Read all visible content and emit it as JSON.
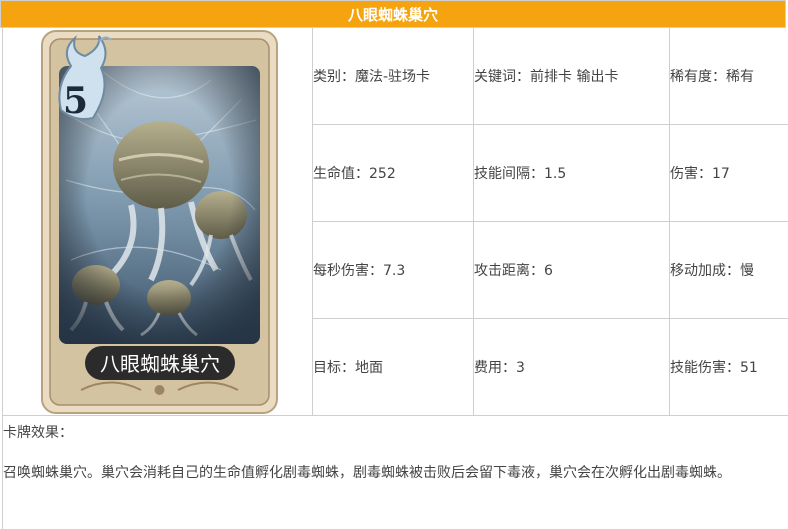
{
  "title": "八眼蜘蛛巢穴",
  "card": {
    "cost": "5",
    "name": "八眼蜘蛛巢穴",
    "colors": {
      "frame": "#c9b79a",
      "inner": "#6d8ea8",
      "banner": "#2b2b2b"
    }
  },
  "stats": [
    [
      "类别：魔法-驻场卡",
      "关键词：前排卡 输出卡",
      "稀有度：稀有"
    ],
    [
      "生命值：252",
      "技能间隔：1.5",
      "伤害：17"
    ],
    [
      "每秒伤害：7.3",
      "攻击距离：6",
      "移动加成：慢"
    ],
    [
      "目标：地面",
      "费用：3",
      "技能伤害：51"
    ]
  ],
  "effects": {
    "label": "卡牌效果：",
    "description": "召唤蜘蛛巢穴。巢穴会消耗自己的生命值孵化剧毒蜘蛛，剧毒蜘蛛被击败后会留下毒液，巢穴会在次孵化出剧毒蜘蛛。"
  },
  "colors": {
    "header_bg": "#f5a40f",
    "border": "#cfcfcf"
  }
}
